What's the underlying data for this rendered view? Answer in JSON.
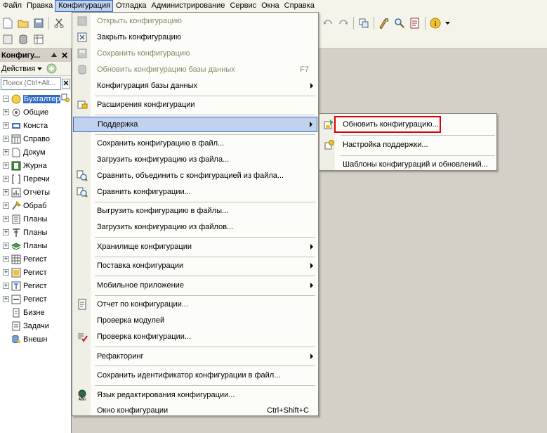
{
  "menubar": {
    "items": [
      {
        "key": "file",
        "label": "Файл"
      },
      {
        "key": "edit",
        "label": "Правка"
      },
      {
        "key": "config",
        "label": "Конфигурация",
        "active": true
      },
      {
        "key": "debug",
        "label": "Отладка"
      },
      {
        "key": "admin",
        "label": "Администрирование"
      },
      {
        "key": "service",
        "label": "Сервис"
      },
      {
        "key": "windows",
        "label": "Окна"
      },
      {
        "key": "help",
        "label": "Справка"
      }
    ]
  },
  "panel": {
    "title": "Конфигу...",
    "close": "✕",
    "actions_label": "Действия",
    "search_placeholder": "Поиск (Ctrl+Alt...",
    "search_clear": "✕",
    "tree": [
      {
        "label": "Бухгалтер",
        "icon": "config-root-icon",
        "selected": true,
        "expander": "-"
      },
      {
        "label": "Общие",
        "icon": "common-icon",
        "expander": "+"
      },
      {
        "label": "Конста",
        "icon": "constants-icon",
        "expander": "+"
      },
      {
        "label": "Справо",
        "icon": "catalogs-icon",
        "expander": "+"
      },
      {
        "label": "Докум",
        "icon": "documents-icon",
        "expander": "+"
      },
      {
        "label": "Журна",
        "icon": "journals-icon",
        "expander": "+"
      },
      {
        "label": "Перечи",
        "icon": "enums-icon",
        "expander": "+"
      },
      {
        "label": "Отчеты",
        "icon": "reports-icon",
        "expander": "+"
      },
      {
        "label": "Обраб",
        "icon": "dataprocessors-icon",
        "expander": "+"
      },
      {
        "label": "Планы",
        "icon": "chart-of-characteristics-icon",
        "expander": "+"
      },
      {
        "label": "Планы",
        "icon": "chart-of-accounts-icon",
        "expander": "+"
      },
      {
        "label": "Планы",
        "icon": "chart-of-calc-icon",
        "expander": "+"
      },
      {
        "label": "Регист",
        "icon": "info-registers-icon",
        "expander": "+"
      },
      {
        "label": "Регист",
        "icon": "accum-registers-icon",
        "expander": "+"
      },
      {
        "label": "Регист",
        "icon": "accounting-registers-icon",
        "expander": "+"
      },
      {
        "label": "Регист",
        "icon": "calc-registers-icon",
        "expander": "+"
      },
      {
        "label": "Бизне",
        "icon": "business-process-icon",
        "expander": ""
      },
      {
        "label": "Задачи",
        "icon": "tasks-icon",
        "expander": ""
      },
      {
        "label": "Внешн",
        "icon": "external-sources-icon",
        "expander": ""
      }
    ]
  },
  "config_menu": {
    "items": [
      {
        "type": "item",
        "label": "Открыть конфигурацию",
        "disabled": true,
        "icon": "open-config-icon"
      },
      {
        "type": "item",
        "label": "Закрыть конфигурацию",
        "icon": "close-config-icon"
      },
      {
        "type": "item",
        "label": "Сохранить конфигурацию",
        "disabled": true,
        "icon": "save-config-icon"
      },
      {
        "type": "item",
        "label": "Обновить конфигурацию базы данных",
        "disabled": true,
        "shortcut": "F7",
        "icon": "update-db-icon"
      },
      {
        "type": "item",
        "label": "Конфигурация базы данных",
        "submenu": true
      },
      {
        "type": "sep"
      },
      {
        "type": "item",
        "label": "Расширения конфигурации",
        "icon": "extensions-icon"
      },
      {
        "type": "sep"
      },
      {
        "type": "item",
        "label": "Поддержка",
        "submenu": true,
        "highlighted": true
      },
      {
        "type": "sep"
      },
      {
        "type": "item",
        "label": "Сохранить конфигурацию в файл..."
      },
      {
        "type": "item",
        "label": "Загрузить конфигурацию из файла..."
      },
      {
        "type": "item",
        "label": "Сравнить, объединить с конфигурацией из файла...",
        "icon": "compare-merge-icon"
      },
      {
        "type": "item",
        "label": "Сравнить конфигурации...",
        "icon": "compare-icon"
      },
      {
        "type": "sep"
      },
      {
        "type": "item",
        "label": "Выгрузить конфигурацию в файлы..."
      },
      {
        "type": "item",
        "label": "Загрузить конфигурацию из файлов..."
      },
      {
        "type": "sep"
      },
      {
        "type": "item",
        "label": "Хранилище конфигурации",
        "submenu": true
      },
      {
        "type": "sep"
      },
      {
        "type": "item",
        "label": "Поставка конфигурации",
        "submenu": true
      },
      {
        "type": "sep"
      },
      {
        "type": "item",
        "label": "Мобильное приложение",
        "submenu": true
      },
      {
        "type": "sep"
      },
      {
        "type": "item",
        "label": "Отчет по конфигурации...",
        "icon": "report-icon"
      },
      {
        "type": "item",
        "label": "Проверка модулей"
      },
      {
        "type": "item",
        "label": "Проверка конфигурации...",
        "icon": "check-config-icon"
      },
      {
        "type": "sep"
      },
      {
        "type": "item",
        "label": "Рефакторинг",
        "submenu": true
      },
      {
        "type": "sep"
      },
      {
        "type": "item",
        "label": "Сохранить идентификатор конфигурации в файл..."
      },
      {
        "type": "sep"
      },
      {
        "type": "item",
        "label": "Язык редактирования конфигурации...",
        "icon": "language-icon"
      },
      {
        "type": "item",
        "label": "Окно конфигурации",
        "shortcut": "Ctrl+Shift+C"
      }
    ]
  },
  "support_submenu": {
    "items": [
      {
        "type": "item",
        "label": "Обновить конфигурацию...",
        "icon": "update-config-icon",
        "emphasized": true
      },
      {
        "type": "sep"
      },
      {
        "type": "item",
        "label": "Настройка поддержки...",
        "icon": "support-settings-icon"
      },
      {
        "type": "sep"
      },
      {
        "type": "item",
        "label": "Шаблоны конфигураций и обновлений..."
      }
    ]
  },
  "colors": {
    "menu_highlight": "#c1d2ee",
    "menu_highlight_border": "#316ac5",
    "annotation_red": "#e0000b",
    "disabled_text": "#8b8766"
  }
}
